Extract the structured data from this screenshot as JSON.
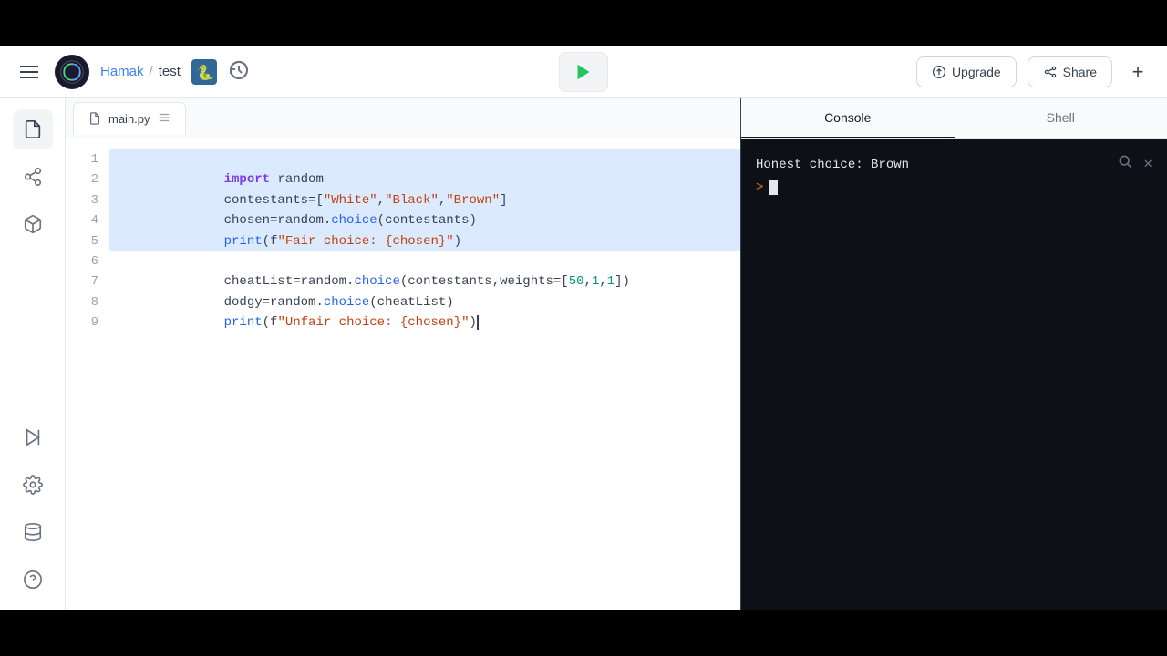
{
  "topBar": {},
  "header": {
    "breadcrumb": {
      "username": "Hamak",
      "separator": "/",
      "project": "test"
    },
    "runButton": "▶",
    "upgradeLabel": "Upgrade",
    "shareLabel": "Share",
    "addLabel": "+"
  },
  "sidebar": {
    "icons": [
      {
        "name": "file-icon",
        "symbol": "📄"
      },
      {
        "name": "share-icon",
        "symbol": "↗"
      },
      {
        "name": "cube-icon",
        "symbol": "⬡"
      },
      {
        "name": "play-pause-icon",
        "symbol": "⏯"
      },
      {
        "name": "settings-icon",
        "symbol": "⚙"
      },
      {
        "name": "database-icon",
        "symbol": "🗄"
      },
      {
        "name": "help-icon",
        "symbol": "?"
      }
    ]
  },
  "editor": {
    "tab": {
      "filename": "main.py"
    },
    "lines": [
      {
        "num": 1,
        "selected": true,
        "content": "import random"
      },
      {
        "num": 2,
        "selected": true,
        "content": "contestants=[\"White\",\"Black\",\"Brown\"]"
      },
      {
        "num": 3,
        "selected": true,
        "content": "chosen=random.choice(contestants)"
      },
      {
        "num": 4,
        "selected": true,
        "content": "print(f\"Fair choice: {chosen}\")"
      },
      {
        "num": 5,
        "selected": true,
        "content": ""
      },
      {
        "num": 6,
        "selected": false,
        "content": "cheatList=random.choice(contestants,weights=[50,1,1])"
      },
      {
        "num": 7,
        "selected": false,
        "content": "dodgy=random.choice(cheatList)"
      },
      {
        "num": 8,
        "selected": false,
        "content": "print(f\"Unfair choice: {chosen}\")"
      },
      {
        "num": 9,
        "selected": false,
        "content": ""
      }
    ]
  },
  "rightPanel": {
    "tabs": [
      {
        "label": "Console",
        "active": true
      },
      {
        "label": "Shell",
        "active": false
      }
    ],
    "console": {
      "output": "Honest choice: Brown",
      "prompt": ">"
    }
  }
}
